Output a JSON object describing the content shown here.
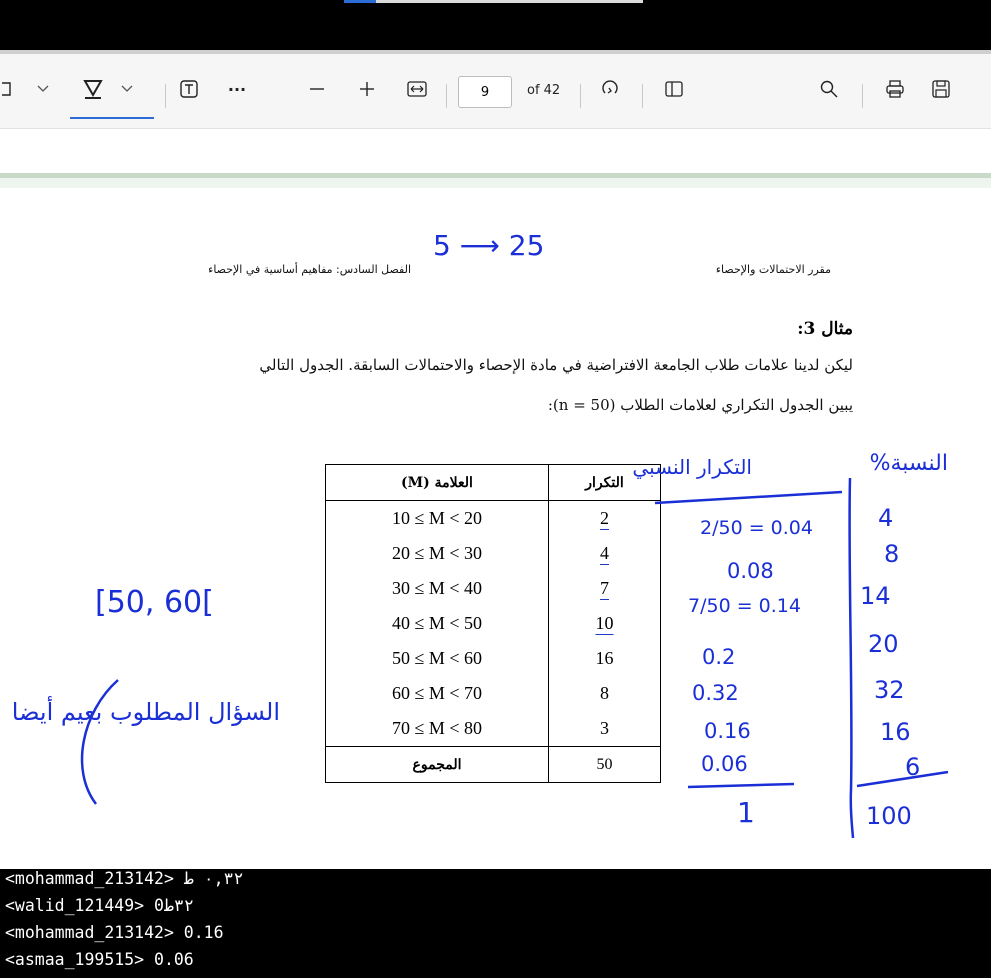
{
  "toolbar": {
    "page_number": "9",
    "page_of": "of 42",
    "more_label": "···"
  },
  "document": {
    "header_right": "مقرر الاحتمالات والإحصاء",
    "header_left": "الفصل السادس: مفاهيم أساسية في الإحصاء",
    "example_title": "مثال 3:",
    "paragraph_line1": "ليكن لدينا علامات طلاب الجامعة الافتراضية في مادة الإحصاء والاحتمالات السابقة. الجدول التالي",
    "paragraph_line2": "يبين الجدول التكراري لعلامات الطلاب (n = 50):",
    "table": {
      "col_range": "العلامة (M)",
      "col_freq": "التكرار",
      "rows": [
        {
          "range": "10 ≤ M < 20",
          "freq": "2"
        },
        {
          "range": "20 ≤ M < 30",
          "freq": "4"
        },
        {
          "range": "30 ≤ M < 40",
          "freq": "7"
        },
        {
          "range": "40 ≤ M < 50",
          "freq": "10"
        },
        {
          "range": "50 ≤ M < 60",
          "freq": "16"
        },
        {
          "range": "60 ≤ M < 70",
          "freq": "8"
        },
        {
          "range": "70 ≤ M < 80",
          "freq": "3"
        }
      ],
      "total_label": "المجموع",
      "total_value": "50"
    }
  },
  "annotations": {
    "color": "#1b2fd6",
    "top_note": "5 ⟶ 25",
    "relative_header": "التكرار النسبي",
    "percent_header": "النسبة%",
    "relative_values": [
      "2/50 = 0.04",
      "0.08",
      "7/50 = 0.14",
      "0.2",
      "0.32",
      "0.16",
      "0.06"
    ],
    "relative_total": "1",
    "percent_values": [
      "4",
      "8",
      "14",
      "20",
      "32",
      "16",
      "6"
    ],
    "percent_total": "100",
    "interval_note": "[50, 60[",
    "question_note": "السؤال المطلوب بعيم أيضا"
  },
  "chat": {
    "lines": [
      "<mohammad_213142> ٠,٣٢ ط",
      "<walid_121449> ٣٢ط0",
      "<mohammad_213142> 0.16",
      "<asmaa_199515> 0.06"
    ]
  }
}
